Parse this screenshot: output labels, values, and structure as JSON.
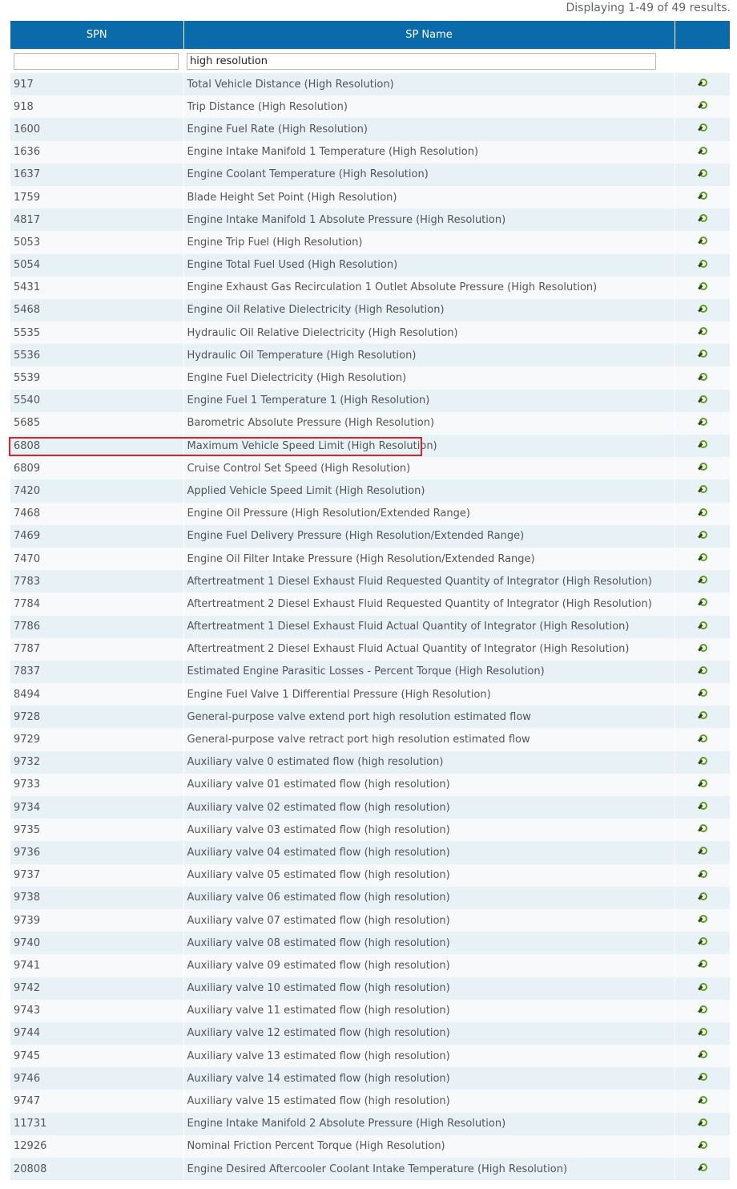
{
  "summary": "Displaying 1-49 of 49 results.",
  "columns": {
    "spn": "SPN",
    "sp_name": "SP Name",
    "actions": ""
  },
  "filters": {
    "spn": "",
    "sp_name": "high resolution"
  },
  "rows": [
    {
      "spn": "917",
      "name": "Total Vehicle Distance (High Resolution)"
    },
    {
      "spn": "918",
      "name": "Trip Distance (High Resolution)"
    },
    {
      "spn": "1600",
      "name": "Engine Fuel Rate (High Resolution)"
    },
    {
      "spn": "1636",
      "name": "Engine Intake Manifold 1 Temperature (High Resolution)"
    },
    {
      "spn": "1637",
      "name": "Engine Coolant Temperature (High Resolution)"
    },
    {
      "spn": "1759",
      "name": "Blade Height Set Point (High Resolution)"
    },
    {
      "spn": "4817",
      "name": "Engine Intake Manifold 1 Absolute Pressure (High Resolution)"
    },
    {
      "spn": "5053",
      "name": "Engine Trip Fuel (High Resolution)"
    },
    {
      "spn": "5054",
      "name": "Engine Total Fuel Used (High Resolution)"
    },
    {
      "spn": "5431",
      "name": "Engine Exhaust Gas Recirculation 1 Outlet Absolute Pressure (High Resolution)"
    },
    {
      "spn": "5468",
      "name": "Engine Oil Relative Dielectricity (High Resolution)"
    },
    {
      "spn": "5535",
      "name": "Hydraulic Oil Relative Dielectricity (High Resolution)"
    },
    {
      "spn": "5536",
      "name": "Hydraulic Oil Temperature (High Resolution)"
    },
    {
      "spn": "5539",
      "name": "Engine Fuel Dielectricity (High Resolution)"
    },
    {
      "spn": "5540",
      "name": "Engine Fuel 1 Temperature 1 (High Resolution)"
    },
    {
      "spn": "5685",
      "name": "Barometric Absolute Pressure (High Resolution)"
    },
    {
      "spn": "6808",
      "name": "Maximum Vehicle Speed Limit (High Resolution)"
    },
    {
      "spn": "6809",
      "name": "Cruise Control Set Speed (High Resolution)"
    },
    {
      "spn": "7420",
      "name": "Applied Vehicle Speed Limit (High Resolution)"
    },
    {
      "spn": "7468",
      "name": "Engine Oil Pressure (High Resolution/Extended Range)"
    },
    {
      "spn": "7469",
      "name": "Engine Fuel Delivery Pressure (High Resolution/Extended Range)"
    },
    {
      "spn": "7470",
      "name": "Engine Oil Filter Intake Pressure (High Resolution/Extended Range)"
    },
    {
      "spn": "7783",
      "name": "Aftertreatment 1 Diesel Exhaust Fluid Requested Quantity of Integrator (High Resolution)"
    },
    {
      "spn": "7784",
      "name": "Aftertreatment 2 Diesel Exhaust Fluid Requested Quantity of Integrator (High Resolution)"
    },
    {
      "spn": "7786",
      "name": "Aftertreatment 1 Diesel Exhaust Fluid Actual Quantity of Integrator (High Resolution)"
    },
    {
      "spn": "7787",
      "name": "Aftertreatment 2 Diesel Exhaust Fluid Actual Quantity of Integrator (High Resolution)"
    },
    {
      "spn": "7837",
      "name": "Estimated Engine Parasitic Losses - Percent Torque (High Resolution)"
    },
    {
      "spn": "8494",
      "name": "Engine Fuel Valve 1 Differential Pressure (High Resolution)"
    },
    {
      "spn": "9728",
      "name": "General-purpose valve extend port high resolution estimated flow"
    },
    {
      "spn": "9729",
      "name": "General-purpose valve retract port high resolution estimated flow"
    },
    {
      "spn": "9732",
      "name": "Auxiliary valve 0 estimated flow (high resolution)"
    },
    {
      "spn": "9733",
      "name": "Auxiliary valve 01 estimated flow (high resolution)"
    },
    {
      "spn": "9734",
      "name": "Auxiliary valve 02 estimated flow (high resolution)"
    },
    {
      "spn": "9735",
      "name": "Auxiliary valve 03 estimated flow (high resolution)"
    },
    {
      "spn": "9736",
      "name": "Auxiliary valve 04 estimated flow (high resolution)"
    },
    {
      "spn": "9737",
      "name": "Auxiliary valve 05 estimated flow (high resolution)"
    },
    {
      "spn": "9738",
      "name": "Auxiliary valve 06 estimated flow (high resolution)"
    },
    {
      "spn": "9739",
      "name": "Auxiliary valve 07 estimated flow (high resolution)"
    },
    {
      "spn": "9740",
      "name": "Auxiliary valve 08 estimated flow (high resolution)"
    },
    {
      "spn": "9741",
      "name": "Auxiliary valve 09 estimated flow (high resolution)"
    },
    {
      "spn": "9742",
      "name": "Auxiliary valve 10 estimated flow (high resolution)"
    },
    {
      "spn": "9743",
      "name": "Auxiliary valve 11 estimated flow (high resolution)"
    },
    {
      "spn": "9744",
      "name": "Auxiliary valve 12 estimated flow (high resolution)"
    },
    {
      "spn": "9745",
      "name": "Auxiliary valve 13 estimated flow (high resolution)"
    },
    {
      "spn": "9746",
      "name": "Auxiliary valve 14 estimated flow (high resolution)"
    },
    {
      "spn": "9747",
      "name": "Auxiliary valve 15 estimated flow (high resolution)"
    },
    {
      "spn": "11731",
      "name": "Engine Intake Manifold 2 Absolute Pressure (High Resolution)"
    },
    {
      "spn": "12926",
      "name": "Nominal Friction Percent Torque (High Resolution)"
    },
    {
      "spn": "20808",
      "name": "Engine Desired Aftercooler Coolant Intake Temperature (High Resolution)"
    }
  ],
  "row_action_icon": "magnifier-view-icon",
  "colors": {
    "header_bg": "#0a6aaa",
    "row_odd": "#e7f1f6",
    "row_even": "#f7f9fa",
    "highlight_border": "#d7262b",
    "icon_green": "#5e9b2d"
  }
}
